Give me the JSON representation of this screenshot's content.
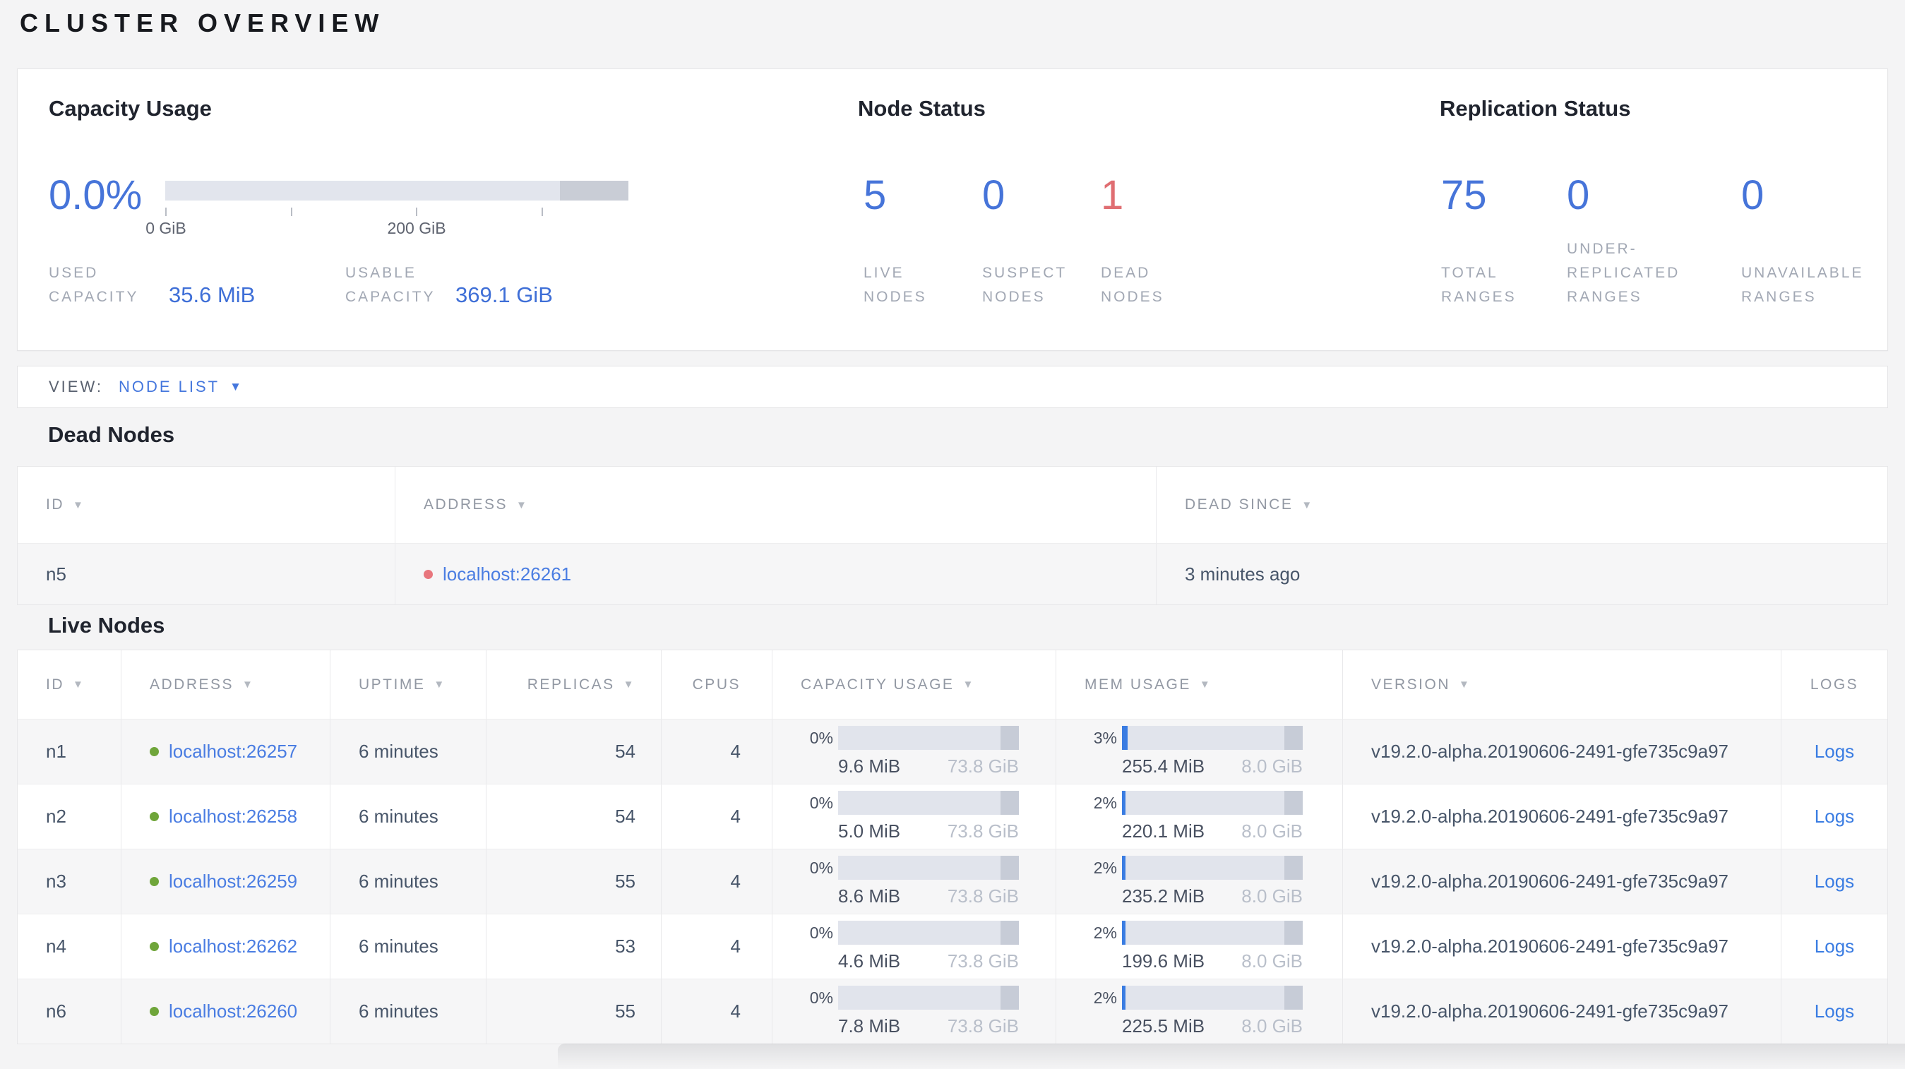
{
  "title": "CLUSTER OVERVIEW",
  "icons": {
    "sort_desc": "▼",
    "caret_down": "▼"
  },
  "colors": {
    "accent_blue": "#4674d9",
    "link_blue": "#4a7de2",
    "danger_red": "#e06e72",
    "live_green": "#6fa53a",
    "bar_track": "#e2e5ed",
    "bar_reserved": "#c9cdd6"
  },
  "summary": {
    "capacity": {
      "heading": "Capacity Usage",
      "percent": "0.0%",
      "tick_labels": [
        "0 GiB",
        "200 GiB"
      ],
      "used": {
        "label": "USED CAPACITY",
        "value": "35.6 MiB"
      },
      "usable": {
        "label": "USABLE CAPACITY",
        "value": "369.1 GiB"
      }
    },
    "node_status": {
      "heading": "Node Status",
      "items": [
        {
          "value": "5",
          "label": "LIVE NODES"
        },
        {
          "value": "0",
          "label": "SUSPECT NODES"
        },
        {
          "value": "1",
          "label": "DEAD NODES"
        }
      ]
    },
    "replication_status": {
      "heading": "Replication Status",
      "items": [
        {
          "value": "75",
          "label": "TOTAL RANGES"
        },
        {
          "value": "0",
          "label": "UNDER-REPLICATED RANGES"
        },
        {
          "value": "0",
          "label": "UNAVAILABLE RANGES"
        }
      ]
    }
  },
  "view_bar": {
    "label": "VIEW:",
    "selected": "NODE LIST"
  },
  "dead_nodes": {
    "heading": "Dead Nodes",
    "columns": [
      {
        "label": "ID"
      },
      {
        "label": "ADDRESS"
      },
      {
        "label": "DEAD SINCE"
      }
    ],
    "rows": [
      {
        "id": "n5",
        "address": "localhost:26261",
        "dead_since": "3 minutes ago"
      }
    ]
  },
  "live_nodes": {
    "heading": "Live Nodes",
    "columns": [
      {
        "label": "ID"
      },
      {
        "label": "ADDRESS"
      },
      {
        "label": "UPTIME"
      },
      {
        "label": "REPLICAS"
      },
      {
        "label": "CPUS"
      },
      {
        "label": "CAPACITY USAGE"
      },
      {
        "label": "MEM USAGE"
      },
      {
        "label": "VERSION"
      },
      {
        "label": "LOGS"
      }
    ],
    "rows": [
      {
        "id": "n1",
        "address": "localhost:26257",
        "uptime": "6 minutes",
        "replicas": "54",
        "cpus": "4",
        "capacity": {
          "percent": "0%",
          "fill": "0%",
          "used": "9.6 MiB",
          "total": "73.8 GiB"
        },
        "memory": {
          "percent": "3%",
          "fill": "3%",
          "used": "255.4 MiB",
          "total": "8.0 GiB"
        },
        "version": "v19.2.0-alpha.20190606-2491-gfe735c9a97",
        "logs_label": "Logs"
      },
      {
        "id": "n2",
        "address": "localhost:26258",
        "uptime": "6 minutes",
        "replicas": "54",
        "cpus": "4",
        "capacity": {
          "percent": "0%",
          "fill": "0%",
          "used": "5.0 MiB",
          "total": "73.8 GiB"
        },
        "memory": {
          "percent": "2%",
          "fill": "2%",
          "used": "220.1 MiB",
          "total": "8.0 GiB"
        },
        "version": "v19.2.0-alpha.20190606-2491-gfe735c9a97",
        "logs_label": "Logs"
      },
      {
        "id": "n3",
        "address": "localhost:26259",
        "uptime": "6 minutes",
        "replicas": "55",
        "cpus": "4",
        "capacity": {
          "percent": "0%",
          "fill": "0%",
          "used": "8.6 MiB",
          "total": "73.8 GiB"
        },
        "memory": {
          "percent": "2%",
          "fill": "2%",
          "used": "235.2 MiB",
          "total": "8.0 GiB"
        },
        "version": "v19.2.0-alpha.20190606-2491-gfe735c9a97",
        "logs_label": "Logs"
      },
      {
        "id": "n4",
        "address": "localhost:26262",
        "uptime": "6 minutes",
        "replicas": "53",
        "cpus": "4",
        "capacity": {
          "percent": "0%",
          "fill": "0%",
          "used": "4.6 MiB",
          "total": "73.8 GiB"
        },
        "memory": {
          "percent": "2%",
          "fill": "2%",
          "used": "199.6 MiB",
          "total": "8.0 GiB"
        },
        "version": "v19.2.0-alpha.20190606-2491-gfe735c9a97",
        "logs_label": "Logs"
      },
      {
        "id": "n6",
        "address": "localhost:26260",
        "uptime": "6 minutes",
        "replicas": "55",
        "cpus": "4",
        "capacity": {
          "percent": "0%",
          "fill": "0%",
          "used": "7.8 MiB",
          "total": "73.8 GiB"
        },
        "memory": {
          "percent": "2%",
          "fill": "2%",
          "used": "225.5 MiB",
          "total": "8.0 GiB"
        },
        "version": "v19.2.0-alpha.20190606-2491-gfe735c9a97",
        "logs_label": "Logs"
      }
    ]
  }
}
